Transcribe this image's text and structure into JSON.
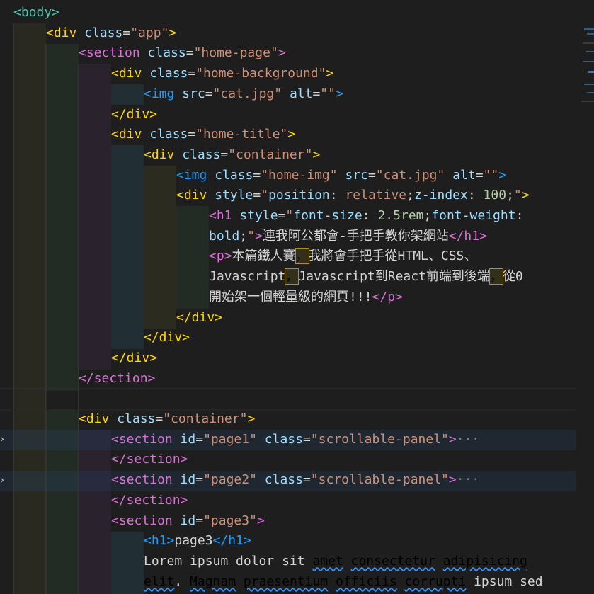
{
  "colors": {
    "background": "#1e1e1e",
    "tag_level1": "#ffd700",
    "tag_level2": "#da70d6",
    "tag_level3": "#179fff",
    "attribute": "#9cdcfe",
    "string": "#ce9178",
    "text": "#d4d4d4"
  },
  "lines": [
    {
      "id": "l1",
      "tokens": [
        [
          "tag-g",
          "<body>"
        ]
      ]
    },
    {
      "id": "l2",
      "tokens": [
        [
          "tag-y",
          "<div "
        ],
        [
          "attr",
          "class"
        ],
        [
          "eq",
          "="
        ],
        [
          "str",
          "\"app\""
        ],
        [
          "tag-y",
          ">"
        ]
      ]
    },
    {
      "id": "l3",
      "tokens": [
        [
          "tag-p",
          "<section "
        ],
        [
          "attr",
          "class"
        ],
        [
          "eq",
          "="
        ],
        [
          "str",
          "\"home-page\""
        ],
        [
          "tag-p",
          ">"
        ]
      ]
    },
    {
      "id": "l4",
      "tokens": [
        [
          "tag-y",
          "<div "
        ],
        [
          "attr",
          "class"
        ],
        [
          "eq",
          "="
        ],
        [
          "str",
          "\"home-background\""
        ],
        [
          "tag-y",
          ">"
        ]
      ]
    },
    {
      "id": "l5",
      "tokens": [
        [
          "tag-b",
          "<img "
        ],
        [
          "attr",
          "src"
        ],
        [
          "eq",
          "="
        ],
        [
          "str",
          "\"cat.jpg\""
        ],
        [
          "txtc",
          " "
        ],
        [
          "attr",
          "alt"
        ],
        [
          "eq",
          "="
        ],
        [
          "str",
          "\"\""
        ],
        [
          "tag-b",
          ">"
        ]
      ]
    },
    {
      "id": "l6",
      "tokens": [
        [
          "tag-y",
          "</div>"
        ]
      ]
    },
    {
      "id": "l7",
      "tokens": [
        [
          "tag-y",
          "<div "
        ],
        [
          "attr",
          "class"
        ],
        [
          "eq",
          "="
        ],
        [
          "str",
          "\"home-title\""
        ],
        [
          "tag-y",
          ">"
        ]
      ]
    },
    {
      "id": "l8",
      "tokens": [
        [
          "tag-y",
          "<div "
        ],
        [
          "attr",
          "class"
        ],
        [
          "eq",
          "="
        ],
        [
          "str",
          "\"container\""
        ],
        [
          "tag-y",
          ">"
        ]
      ]
    },
    {
      "id": "l9",
      "tokens": [
        [
          "tag-b",
          "<img "
        ],
        [
          "attr",
          "class"
        ],
        [
          "eq",
          "="
        ],
        [
          "str",
          "\"home-img\""
        ],
        [
          "txtc",
          " "
        ],
        [
          "attr",
          "src"
        ],
        [
          "eq",
          "="
        ],
        [
          "str",
          "\"cat.jpg\""
        ],
        [
          "txtc",
          " "
        ],
        [
          "attr",
          "alt"
        ],
        [
          "eq",
          "="
        ],
        [
          "str",
          "\"\""
        ],
        [
          "tag-b",
          ">"
        ]
      ]
    },
    {
      "id": "l10",
      "tokens": [
        [
          "tag-y",
          "<div "
        ],
        [
          "attr",
          "style"
        ],
        [
          "eq",
          "="
        ],
        [
          "str",
          "\""
        ],
        [
          "attr",
          "position"
        ],
        [
          "txtc",
          ": "
        ],
        [
          "str",
          "relative"
        ],
        [
          "txtc",
          ";"
        ],
        [
          "attr",
          "z-index"
        ],
        [
          "txtc",
          ": "
        ],
        [
          "num",
          "100"
        ],
        [
          "txtc",
          ";"
        ],
        [
          "str",
          "\""
        ],
        [
          "tag-y",
          ">"
        ]
      ]
    },
    {
      "id": "l11",
      "tokens": [
        [
          "tag-p",
          "<h1 "
        ],
        [
          "attr",
          "style"
        ],
        [
          "eq",
          "="
        ],
        [
          "str",
          "\""
        ],
        [
          "attr",
          "font-size"
        ],
        [
          "txtc",
          ": "
        ],
        [
          "num",
          "2.5rem"
        ],
        [
          "txtc",
          ";"
        ],
        [
          "attr",
          "font-weight"
        ],
        [
          "txtc",
          ":"
        ]
      ]
    },
    {
      "id": "l12",
      "tokens": [
        [
          "attr",
          "bold"
        ],
        [
          "txtc",
          ";"
        ],
        [
          "str",
          "\""
        ],
        [
          "tag-p",
          ">"
        ],
        [
          "txtc",
          "連我阿公都會-手把手教你架網站"
        ],
        [
          "tag-p",
          "</h1>"
        ]
      ]
    },
    {
      "id": "l13",
      "tokens": [
        [
          "tag-p",
          "<p>"
        ],
        [
          "txtc",
          "本篇鐵人賽"
        ],
        [
          "boxed",
          "，"
        ],
        [
          "txtc",
          "我將會手把手從HTML、CSS、"
        ]
      ]
    },
    {
      "id": "l14",
      "tokens": [
        [
          "txtc",
          "Javascript"
        ],
        [
          "boxed",
          "，"
        ],
        [
          "txtc",
          "Javascript到React前端到後端"
        ],
        [
          "boxed",
          "，"
        ],
        [
          "txtc",
          "從0"
        ]
      ]
    },
    {
      "id": "l15",
      "tokens": [
        [
          "txtc",
          "開始架一個輕量級的網頁!!!"
        ],
        [
          "tag-p",
          "</p>"
        ]
      ]
    },
    {
      "id": "l16",
      "tokens": [
        [
          "tag-y",
          "</div>"
        ]
      ]
    },
    {
      "id": "l17",
      "tokens": [
        [
          "tag-y",
          "</div>"
        ]
      ]
    },
    {
      "id": "l18",
      "tokens": [
        [
          "tag-y",
          "</div>"
        ]
      ]
    },
    {
      "id": "l19",
      "tokens": [
        [
          "tag-p",
          "</section>"
        ]
      ]
    },
    {
      "id": "l20",
      "tokens": []
    },
    {
      "id": "l21",
      "tokens": [
        [
          "tag-y",
          "<div "
        ],
        [
          "attr",
          "class"
        ],
        [
          "eq",
          "="
        ],
        [
          "str",
          "\"container\""
        ],
        [
          "tag-y",
          ">"
        ]
      ]
    },
    {
      "id": "l22",
      "tokens": [
        [
          "tag-p",
          "<section "
        ],
        [
          "attr",
          "id"
        ],
        [
          "eq",
          "="
        ],
        [
          "str",
          "\"page1\""
        ],
        [
          "txtc",
          " "
        ],
        [
          "attr",
          "class"
        ],
        [
          "eq",
          "="
        ],
        [
          "str",
          "\"scrollable-panel\""
        ],
        [
          "tag-p",
          ">"
        ],
        [
          "dim",
          "···"
        ]
      ]
    },
    {
      "id": "l23",
      "tokens": [
        [
          "tag-p",
          "</section>"
        ]
      ]
    },
    {
      "id": "l24",
      "tokens": [
        [
          "tag-p",
          "<section "
        ],
        [
          "attr",
          "id"
        ],
        [
          "eq",
          "="
        ],
        [
          "str",
          "\"page2\""
        ],
        [
          "txtc",
          " "
        ],
        [
          "attr",
          "class"
        ],
        [
          "eq",
          "="
        ],
        [
          "str",
          "\"scrollable-panel\""
        ],
        [
          "tag-p",
          ">"
        ],
        [
          "dim",
          "···"
        ]
      ]
    },
    {
      "id": "l25",
      "tokens": [
        [
          "tag-p",
          "</section>"
        ]
      ]
    },
    {
      "id": "l26",
      "tokens": [
        [
          "tag-p",
          "<section "
        ],
        [
          "attr",
          "id"
        ],
        [
          "eq",
          "="
        ],
        [
          "str",
          "\"page3\""
        ],
        [
          "tag-p",
          ">"
        ]
      ]
    },
    {
      "id": "l27",
      "tokens": [
        [
          "tag-b",
          "<h1>"
        ],
        [
          "txtc",
          "page3"
        ],
        [
          "tag-b",
          "</h1>"
        ]
      ]
    },
    {
      "id": "l28",
      "tokens": [
        [
          "txtc",
          "Lorem ipsum dolor sit "
        ],
        [
          "squig",
          "amet"
        ],
        [
          "txtc",
          " "
        ],
        [
          "squig",
          "consectetur"
        ],
        [
          "txtc",
          " "
        ],
        [
          "squig",
          "adipisicing"
        ]
      ]
    },
    {
      "id": "l29",
      "tokens": [
        [
          "squig",
          "elit"
        ],
        [
          "txtc",
          ". "
        ],
        [
          "squig",
          "Magnam"
        ],
        [
          "txtc",
          " "
        ],
        [
          "squig",
          "praesentium"
        ],
        [
          "txtc",
          " "
        ],
        [
          "squig",
          "officiis"
        ],
        [
          "txtc",
          " "
        ],
        [
          "squig",
          "corrupti"
        ],
        [
          "txtc",
          " ipsum sed"
        ]
      ]
    }
  ]
}
